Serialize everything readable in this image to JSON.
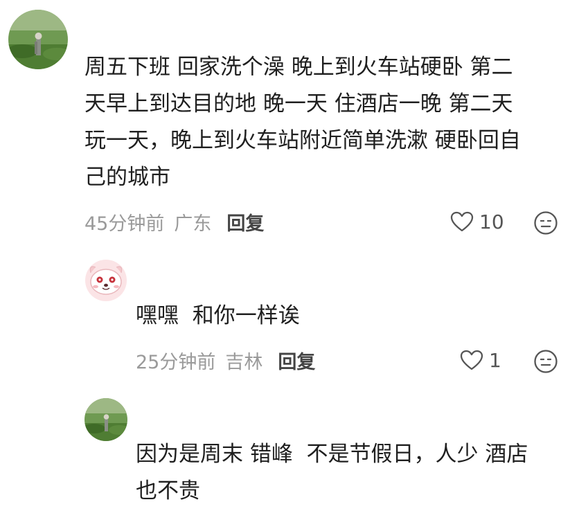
{
  "comments": [
    {
      "avatar_icon": "user-avatar-field-icon",
      "text": "周五下班 回家洗个澡 晚上到火车站硬卧 第二\n天早上到达目的地 晚一天 住酒店一晚 第二天\n玩一天，晚上到火车站附近简单洗漱 硬卧回自\n己的城市",
      "time": "45分钟前",
      "location": "广东",
      "reply_label": "回复",
      "like_count": "10"
    },
    {
      "avatar_icon": "user-avatar-dog-icon",
      "text": "嘿嘿  和你一样诶",
      "time": "25分钟前",
      "location": "吉林",
      "reply_label": "回复",
      "like_count": "1"
    },
    {
      "avatar_icon": "user-avatar-field-icon",
      "text": "因为是周末 错峰  不是节假日，人少 酒店\n也不贵"
    }
  ],
  "icons": {
    "like": "heart-outline-icon",
    "dislike": "unhappy-face-icon"
  }
}
